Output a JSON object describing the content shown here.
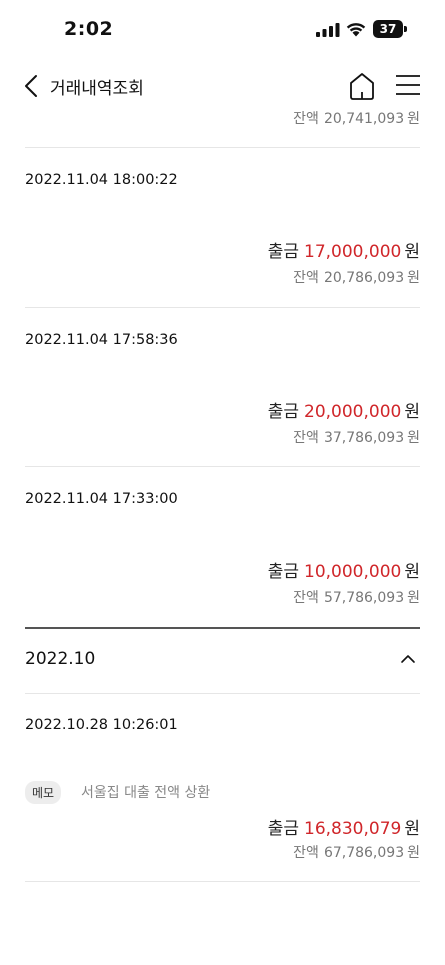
{
  "status_bar": {
    "time": "2:02",
    "battery": "37"
  },
  "header": {
    "title": "거래내역조회",
    "back_icon": "chevron-left-icon",
    "home_icon": "home-icon",
    "menu_icon": "hamburger-menu-icon"
  },
  "top_partial_balance": {
    "label": "잔액",
    "value": "20,741,093",
    "unit": "원"
  },
  "transactions": [
    {
      "datetime": "2022.11.04 18:00:22",
      "type": "출금",
      "amount": "17,000,000",
      "unit": "원",
      "balance_label": "잔액",
      "balance": "20,786,093",
      "balance_unit": "원"
    },
    {
      "datetime": "2022.11.04 17:58:36",
      "type": "출금",
      "amount": "20,000,000",
      "unit": "원",
      "balance_label": "잔액",
      "balance": "37,786,093",
      "balance_unit": "원"
    },
    {
      "datetime": "2022.11.04 17:33:00",
      "type": "출금",
      "amount": "10,000,000",
      "unit": "원",
      "balance_label": "잔액",
      "balance": "57,786,093",
      "balance_unit": "원"
    }
  ],
  "month_section": {
    "label": "2022.10",
    "toggle_icon": "chevron-up-icon"
  },
  "october_transactions": [
    {
      "datetime": "2022.10.28 10:26:01",
      "memo_badge": "메모",
      "memo": "서울집 대출 전액 상환",
      "type": "출금",
      "amount": "16,830,079",
      "unit": "원",
      "balance_label": "잔액",
      "balance": "67,786,093",
      "balance_unit": "원"
    }
  ],
  "colors": {
    "withdrawal_amount": "#d0262a",
    "secondary_text": "#777777",
    "divider": "#e6e6e6"
  }
}
